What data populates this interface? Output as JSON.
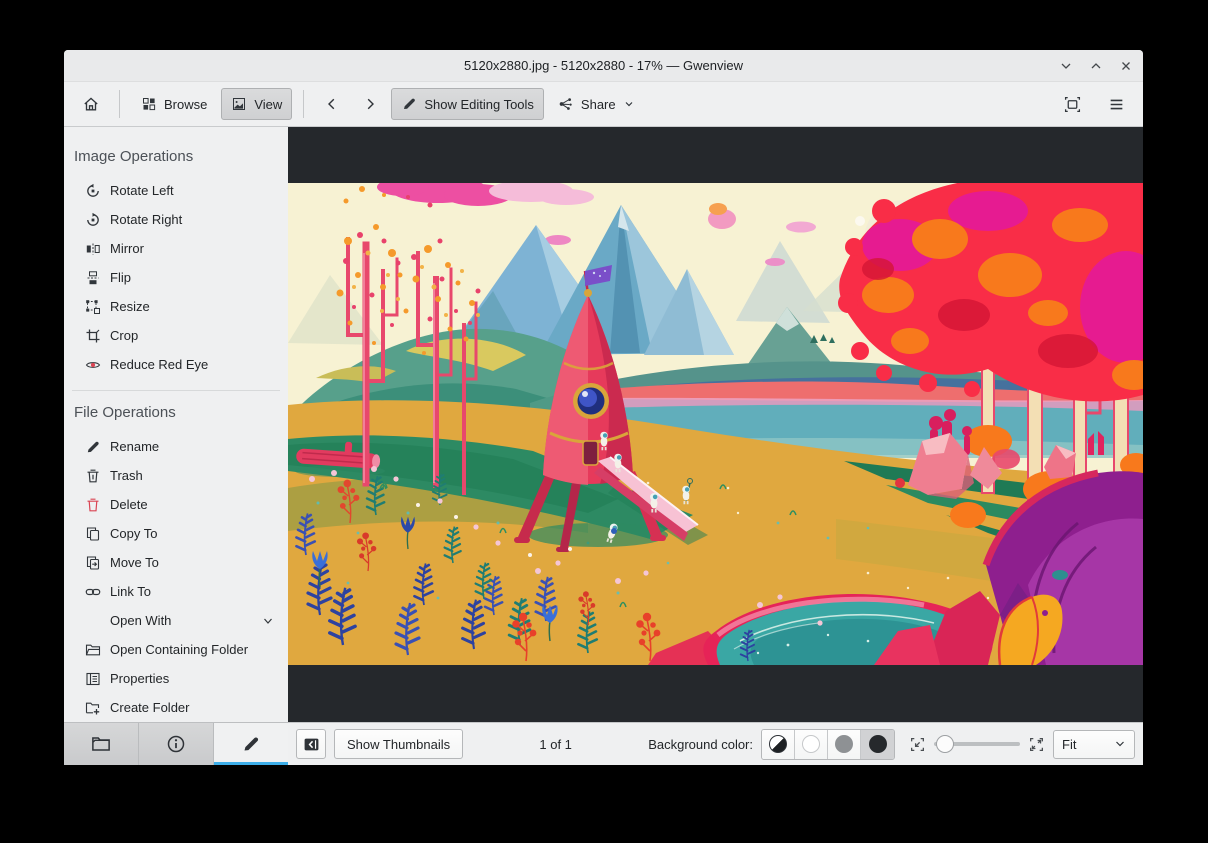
{
  "window": {
    "title": "5120x2880.jpg - 5120x2880 - 17% — Gwenview",
    "controls": [
      "minimize",
      "maximize",
      "close"
    ]
  },
  "toolbar": {
    "browse": "Browse",
    "view": "View",
    "show_editing_tools": "Show Editing Tools",
    "share": "Share"
  },
  "sidebar": {
    "sections": [
      {
        "title": "Image Operations",
        "items": [
          {
            "label": "Rotate Left",
            "icon": "rotate-left"
          },
          {
            "label": "Rotate Right",
            "icon": "rotate-right"
          },
          {
            "label": "Mirror",
            "icon": "mirror"
          },
          {
            "label": "Flip",
            "icon": "flip"
          },
          {
            "label": "Resize",
            "icon": "resize"
          },
          {
            "label": "Crop",
            "icon": "crop"
          },
          {
            "label": "Reduce Red Eye",
            "icon": "red-eye"
          }
        ]
      },
      {
        "title": "File Operations",
        "items": [
          {
            "label": "Rename",
            "icon": "rename-pencil"
          },
          {
            "label": "Trash",
            "icon": "trash"
          },
          {
            "label": "Delete",
            "icon": "delete-red-trash"
          },
          {
            "label": "Copy To",
            "icon": "copy"
          },
          {
            "label": "Move To",
            "icon": "move"
          },
          {
            "label": "Link To",
            "icon": "link"
          },
          {
            "label": "Open With",
            "icon": "none",
            "has_submenu": true
          },
          {
            "label": "Open Containing Folder",
            "icon": "folder-open"
          },
          {
            "label": "Properties",
            "icon": "properties"
          },
          {
            "label": "Create Folder",
            "icon": "folder-new"
          }
        ]
      }
    ],
    "tabs": [
      {
        "icon": "folder",
        "active": false
      },
      {
        "icon": "information",
        "active": false
      },
      {
        "icon": "edit-pencil",
        "active": true
      }
    ]
  },
  "statusbar": {
    "show_thumbnails": "Show Thumbnails",
    "counter": "1 of 1",
    "background_color_label": "Background color:",
    "swatches": [
      "auto",
      "white",
      "gray",
      "black"
    ],
    "selected_swatch": "black",
    "zoom_mode": "Fit"
  },
  "image": {
    "description": "Colorful stylized landscape: pink rocket with ramp and tiny astronauts, red autumn trees, blue mountains, mustard field, teal pond, purple leaves, pale moon in cream sky",
    "palette": {
      "sky": "#f7f2d3",
      "field": "#e0a83f",
      "rocket": "#e63a5b",
      "mountain": "#6aa9c6",
      "canopy": "#f92d47",
      "pond": "#3aa7a4",
      "hills": "#57a08b",
      "accent": "#3daee9"
    }
  }
}
